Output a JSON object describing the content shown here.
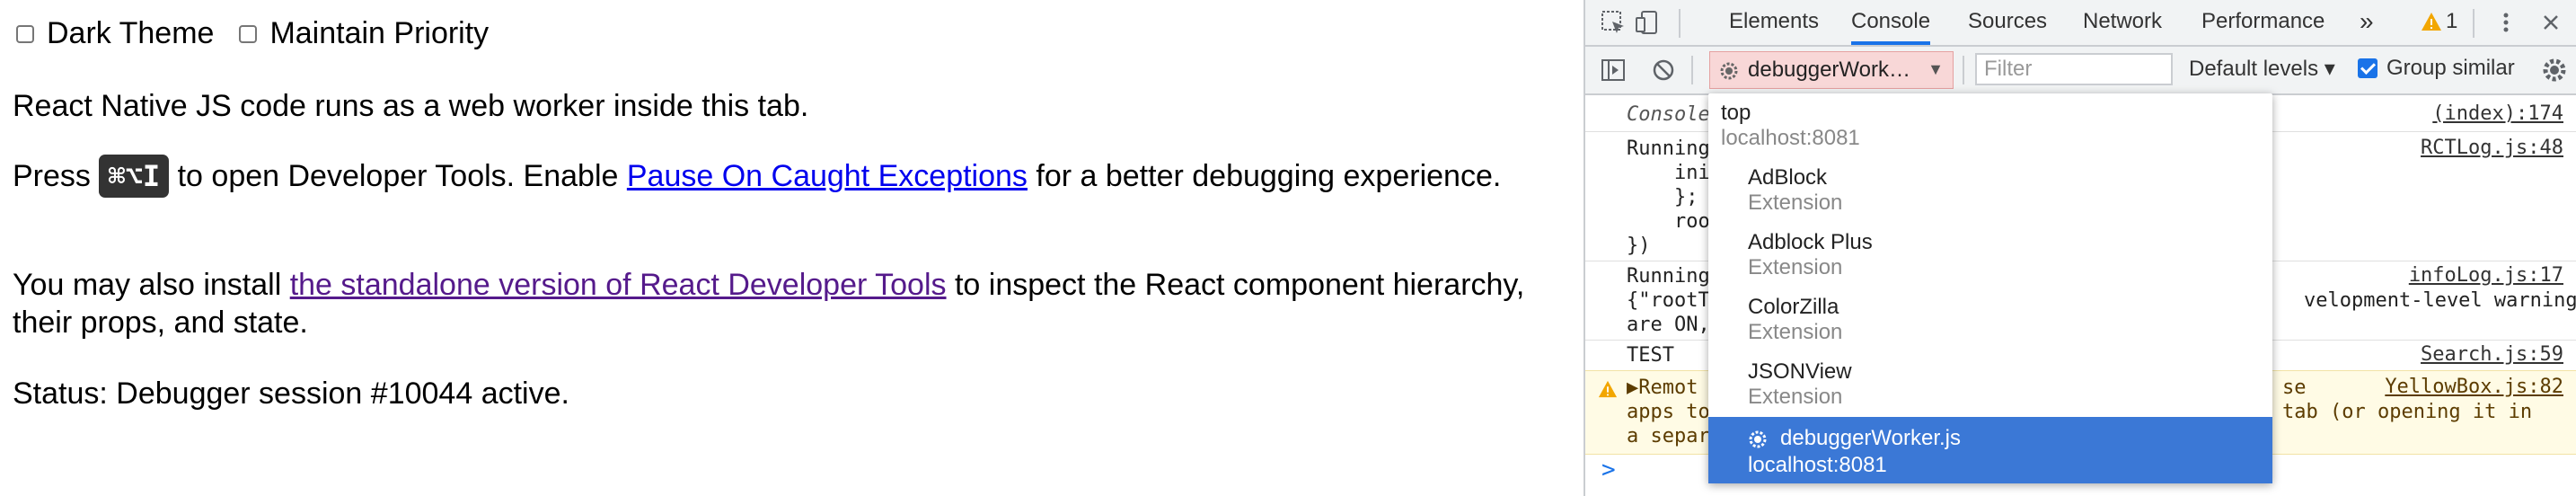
{
  "page": {
    "checkboxes": [
      {
        "label": "Dark Theme",
        "checked": false
      },
      {
        "label": "Maintain Priority",
        "checked": false
      }
    ],
    "intro": "React Native JS code runs as a web worker inside this tab.",
    "press_prefix": "Press ",
    "shortcut": "⌘⌥I",
    "press_middle": " to open Developer Tools. Enable ",
    "pause_link": "Pause On Caught Exceptions",
    "press_suffix": " for a better debugging experience.",
    "install_prefix": "You may also install ",
    "install_link": "the standalone version of React Developer Tools",
    "install_suffix": " to inspect the React component hierarchy, their props, and state.",
    "status": "Status: Debugger session #10044 active."
  },
  "devtools": {
    "tabs": [
      "Elements",
      "Console",
      "Sources",
      "Network",
      "Performance"
    ],
    "active_tab": "Console",
    "overflow": "»",
    "warning_count": "1",
    "context": "debuggerWork…",
    "filter_placeholder": "Filter",
    "levels": "Default levels ▾",
    "group_similar": "Group similar",
    "console_lines": [
      {
        "text": "Console",
        "src": "(index):174"
      },
      {
        "text": "Running",
        "src": "RCTLog.js:48"
      },
      {
        "text": "    ini",
        "src": ""
      },
      {
        "text": "    };",
        "src": ""
      },
      {
        "text": "    roo",
        "src": ""
      },
      {
        "text": "})",
        "src": ""
      },
      {
        "text": "Running",
        "src": "infoLog.js:17"
      },
      {
        "text": "{\"rootT",
        "src": ""
      },
      {
        "text": "are ON,",
        "src": ""
      },
      {
        "text": "TEST",
        "src": "Search.js:59"
      }
    ],
    "right_fragments": {
      "velopment": "velopment-level warning",
      "se": "se",
      "tab": "tab (or opening it in"
    },
    "warning": {
      "line1": "▶Remot",
      "line2": "apps to",
      "line3": "a separ",
      "src": "YellowBox.js:82"
    }
  },
  "dropdown": {
    "top": {
      "title": "top",
      "sub": "localhost:8081"
    },
    "items": [
      {
        "title": "AdBlock",
        "sub": "Extension"
      },
      {
        "title": "Adblock Plus",
        "sub": "Extension"
      },
      {
        "title": "ColorZilla",
        "sub": "Extension"
      },
      {
        "title": "JSONView",
        "sub": "Extension"
      }
    ],
    "selected": {
      "title": "debuggerWorker.js",
      "sub": "localhost:8081"
    }
  }
}
